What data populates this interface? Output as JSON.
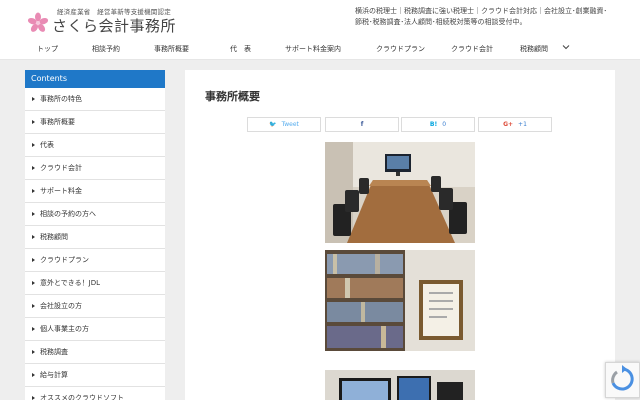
{
  "header": {
    "logo_sub": "経済産業省　経営革新等支援機関認定",
    "logo_title": "さくら会計事務所",
    "tagline": "横浜の税理士｜税務調査に強い税理士｜クラウド会計対応｜会社設立･創業融資･節税･税務調査･法人顧問･相続税対策等の相談受付中。"
  },
  "nav": {
    "items": [
      "トップ",
      "相談予約",
      "事務所概要",
      "代　表",
      "サポート料金案内",
      "クラウドプラン",
      "クラウド会計",
      "税務顧問"
    ]
  },
  "sidebar": {
    "heading": "Contents",
    "items": [
      "事務所の特色",
      "事務所概要",
      "代表",
      "クラウド会計",
      "サポート料金",
      "相談の予約の方へ",
      "税務顧問",
      "クラウドプラン",
      "意外とできる！JDL",
      "会社設立の方",
      "個人事業主の方",
      "税務調査",
      "給与計算",
      "オススメのクラウドソフト"
    ]
  },
  "main": {
    "title": "事務所概要",
    "share": {
      "tweet_label": "Tweet",
      "tweet_icon": "twitter-bird-icon",
      "facebook_icon": "facebook-f-icon",
      "hatena_label": "B!",
      "hatena_count": "0",
      "gplus_label": "G+",
      "gplus_count": "+1"
    }
  },
  "colors": {
    "accent": "#1f78c8",
    "background": "#eeeeee"
  }
}
